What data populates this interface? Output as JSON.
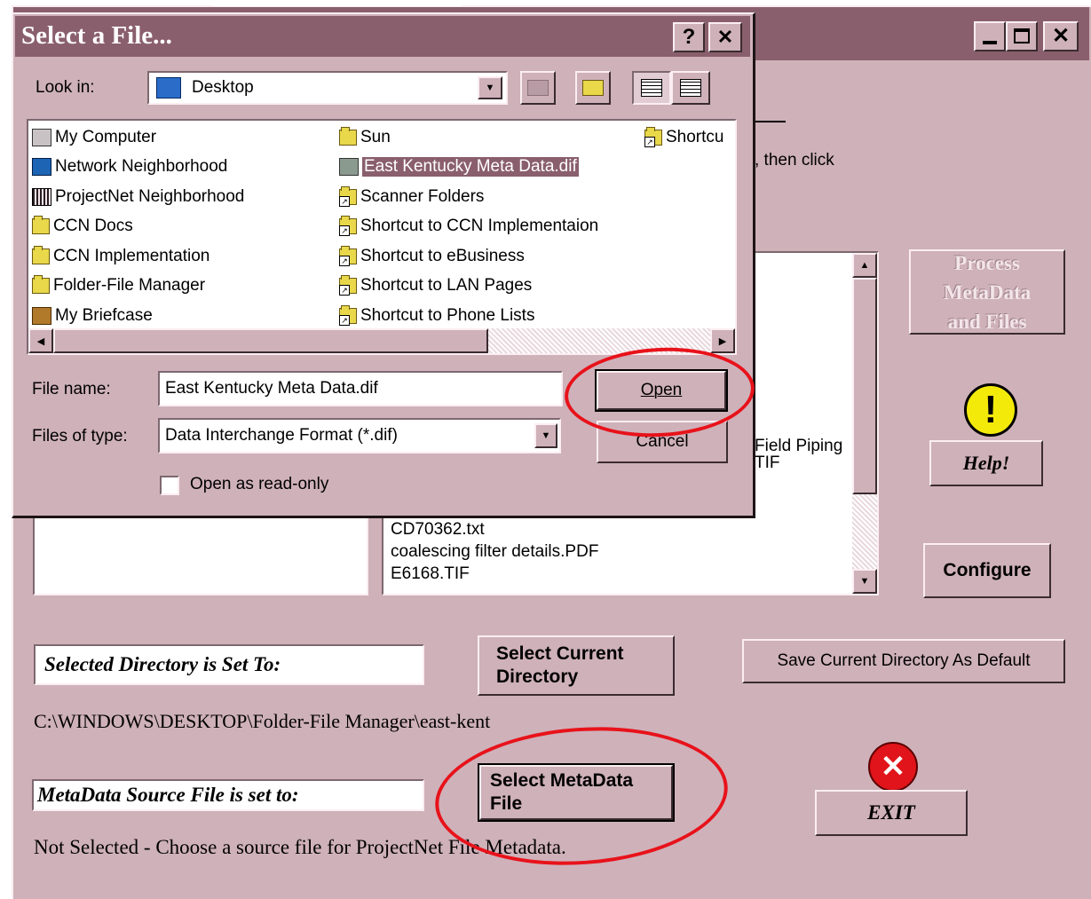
{
  "main": {
    "frag_then_click": ", then click",
    "list_items_bottom": [
      "CD70362.txt",
      "coalescing filter details.PDF",
      "E6168.TIF"
    ],
    "list_items_behind": [
      "Field Piping",
      "TIF"
    ],
    "process_button": "Process MetaData and Files",
    "help_button": "Help!",
    "configure_button": "Configure",
    "selected_dir_label": "Selected Directory is Set To:",
    "select_current_dir_button": "Select Current Directory",
    "save_default_button": "Save Current Directory As Default",
    "current_dir_path": "C:\\WINDOWS\\DESKTOP\\Folder-File Manager\\east-kent",
    "metadata_label": "MetaData Source File is set to:",
    "select_metadata_button": "Select MetaData File",
    "exit_button": "EXIT",
    "status_text": "Not Selected - Choose a source file for ProjectNet File Metadata."
  },
  "dialog": {
    "title": "Select a File...",
    "help_btn": "?",
    "close_btn": "✕",
    "look_in_label": "Look in:",
    "look_in_value": "Desktop",
    "files": [
      {
        "name": "My Computer",
        "icon": "computer-icon"
      },
      {
        "name": "Network Neighborhood",
        "icon": "network-icon"
      },
      {
        "name": "ProjectNet Neighborhood",
        "icon": "projectnet-icon"
      },
      {
        "name": "CCN Docs",
        "icon": "folder-icon"
      },
      {
        "name": "CCN Implementation",
        "icon": "folder-icon"
      },
      {
        "name": "Folder-File Manager",
        "icon": "folder-icon"
      },
      {
        "name": "My Briefcase",
        "icon": "briefcase-icon"
      },
      {
        "name": "Sun",
        "icon": "folder-icon"
      },
      {
        "name": "East Kentucky Meta Data.dif",
        "icon": "dif-file-icon",
        "selected": true
      },
      {
        "name": "Scanner Folders",
        "icon": "folder-shortcut-icon"
      },
      {
        "name": "Shortcut to CCN Implementaion",
        "icon": "folder-shortcut-icon"
      },
      {
        "name": "Shortcut to eBusiness",
        "icon": "folder-shortcut-icon"
      },
      {
        "name": "Shortcut to LAN Pages",
        "icon": "folder-shortcut-icon"
      },
      {
        "name": "Shortcut to Phone Lists",
        "icon": "folder-shortcut-icon"
      },
      {
        "name": "Shortcu",
        "icon": "folder-shortcut-icon"
      }
    ],
    "file_name_label": "File name:",
    "file_name_value": "East Kentucky Meta Data.dif",
    "files_of_type_label": "Files of type:",
    "files_of_type_value": "Data Interchange Format (*.dif)",
    "open_button": "Open",
    "cancel_button": "Cancel",
    "read_only_label": "Open as read-only",
    "read_only_checked": false
  },
  "colors": {
    "window_bg": "#cfb1ba",
    "titlebar": "#8a5f6d",
    "selection": "#8a5f6d",
    "highlight_ellipse": "#e8121a"
  }
}
